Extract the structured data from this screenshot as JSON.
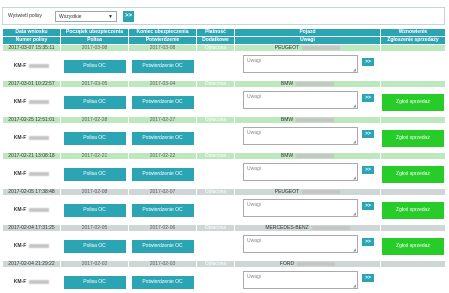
{
  "filter": {
    "label": "Wyświetl polisy",
    "selected": "Wszystkie",
    "arrow": "▼",
    "go_label": ">>"
  },
  "header_top": [
    "Data wniosku",
    "Początek ubezpieczenia",
    "Koniec ubezpieczenia",
    "Płatność",
    "Pojazd",
    "Wznowienie"
  ],
  "header_sub": [
    "Numer polisy",
    "Polisa",
    "Potwierdzenie",
    "Dodatkowe",
    "Uwagi",
    "Zgłoszenie sprzedaży"
  ],
  "labels": {
    "polisa": "Polisa OC",
    "potwierdzenie": "Potwierdzenie OC",
    "uwagi_placeholder": "Uwagi",
    "send": ">>",
    "zglos": "Zgłoś sprzedaż",
    "km_prefix": "KM-F"
  },
  "rows": [
    {
      "data": "2017-03-07 15:35:11",
      "start": "2017-03-08",
      "end": "2017-03-08",
      "platnosc": "Opłacona",
      "pojazd": "PEUGEOT",
      "zglos": false,
      "green": true
    },
    {
      "data": "2017-03-01 10:22:57",
      "start": "2017-03-05",
      "end": "2017-03-04",
      "platnosc": "Opłacona",
      "pojazd": "BMW",
      "zglos": true,
      "green": true
    },
    {
      "data": "2017-02-25 12:51:01",
      "start": "2017-02-28",
      "end": "2017-02-27",
      "platnosc": "Opłacona",
      "pojazd": "BMW",
      "zglos": true,
      "green": true
    },
    {
      "data": "2017-02-21 13:08:18",
      "start": "2017-02-21",
      "end": "2017-02-22",
      "platnosc": "Opłacona",
      "pojazd": "BMW",
      "zglos": true,
      "green": true
    },
    {
      "data": "2017-02-05 17:38:48",
      "start": "2017-02-08",
      "end": "2017-02-07",
      "platnosc": "Opłacona",
      "pojazd": "PEUGEOT",
      "zglos": true,
      "green": false
    },
    {
      "data": "2017-02-04 17:31:25",
      "start": "2017-02-05",
      "end": "2017-02-06",
      "platnosc": "Opłacona",
      "pojazd": "MERCEDES-BENZ",
      "zglos": true,
      "green": false
    },
    {
      "data": "2017-02-04 21:29:22",
      "start": "2017-02-02",
      "end": "2017-02-03",
      "platnosc": "Opłacona",
      "pojazd": "FORD",
      "zglos": false,
      "green": false
    }
  ]
}
